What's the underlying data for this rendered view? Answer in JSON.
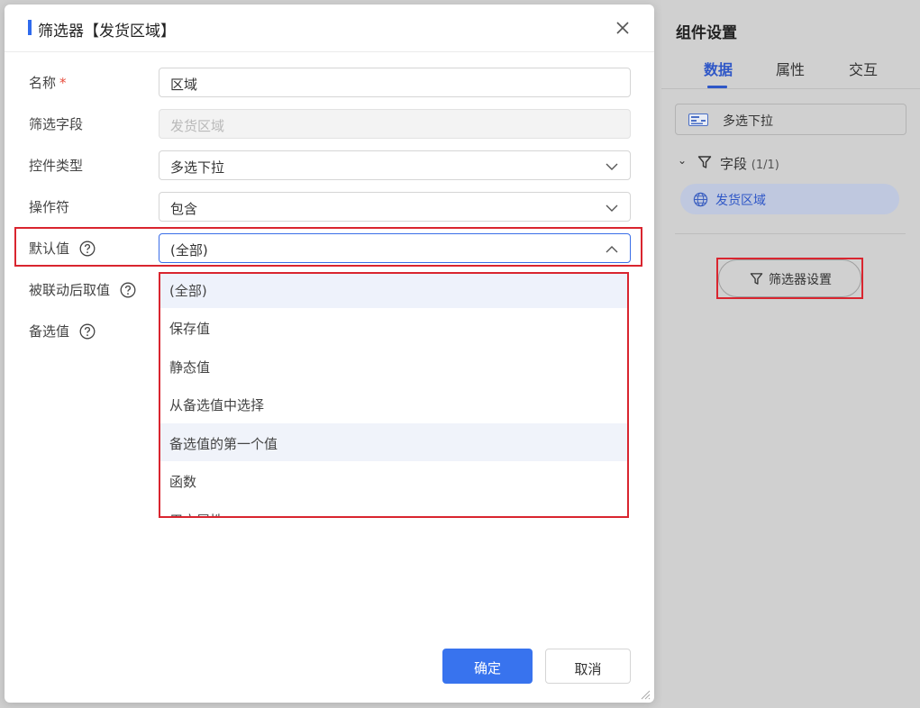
{
  "dialog": {
    "title": "筛选器【发货区域】",
    "rows": {
      "name_label": "名称",
      "name_required": "*",
      "name_value": "区域",
      "field_label": "筛选字段",
      "field_value": "发货区域",
      "control_type_label": "控件类型",
      "control_type_value": "多选下拉",
      "operator_label": "操作符",
      "operator_value": "包含",
      "default_label": "默认值",
      "default_value": "(全部)",
      "linked_label": "被联动后取值",
      "options_label": "备选值"
    },
    "dropdown_items": [
      "(全部)",
      "保存值",
      "静态值",
      "从备选值中选择",
      "备选值的第一个值",
      "函数",
      "用户属性"
    ],
    "ok_label": "确定",
    "cancel_label": "取消"
  },
  "side": {
    "title": "组件设置",
    "tabs": [
      "数据",
      "属性",
      "交互"
    ],
    "chart_type": "多选下拉",
    "field_group_label": "字段",
    "field_group_count": "(1/1)",
    "field_chip": "发货区域",
    "filter_settings_label": "筛选器设置"
  },
  "colors": {
    "accent": "#3873ee",
    "highlight": "#d9252f"
  }
}
